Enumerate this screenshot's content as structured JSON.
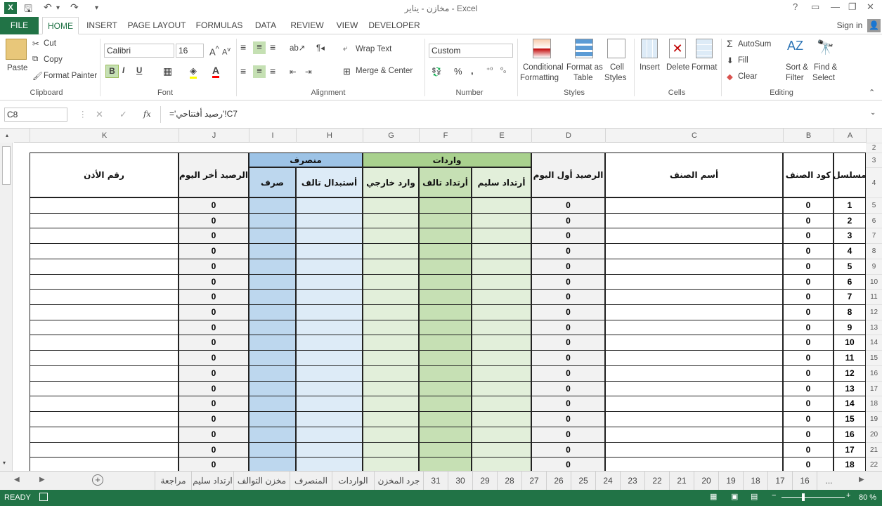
{
  "app": {
    "title": "مخازن - يناير - Excel",
    "help": "?",
    "sign_in": "Sign in"
  },
  "tabs": [
    "FILE",
    "HOME",
    "INSERT",
    "PAGE LAYOUT",
    "FORMULAS",
    "DATA",
    "REVIEW",
    "VIEW",
    "DEVELOPER"
  ],
  "ribbon": {
    "clipboard": {
      "paste": "Paste",
      "cut": "Cut",
      "copy": "Copy",
      "format_painter": "Format Painter",
      "label": "Clipboard"
    },
    "font": {
      "name": "Calibri",
      "size": "16",
      "bold": "B",
      "italic": "I",
      "underline": "U",
      "label": "Font"
    },
    "alignment": {
      "wrap": "Wrap Text",
      "merge": "Merge & Center",
      "label": "Alignment"
    },
    "number": {
      "format": "Custom",
      "percent": "%",
      "comma": ",",
      "label": "Number"
    },
    "styles": {
      "conditional": "Conditional",
      "conditional2": "Formatting",
      "format_as": "Format as",
      "format_as2": "Table",
      "cell": "Cell",
      "cell2": "Styles",
      "label": "Styles"
    },
    "cells": {
      "insert": "Insert",
      "delete": "Delete",
      "format": "Format",
      "label": "Cells"
    },
    "editing": {
      "autosum": "AutoSum",
      "fill": "Fill",
      "clear": "Clear",
      "sort": "Sort &",
      "sort2": "Filter",
      "find": "Find &",
      "find2": "Select",
      "label": "Editing"
    }
  },
  "formula_bar": {
    "name_box": "C8",
    "fx": "fx",
    "formula": "='رصيد أفتتاحي'!C7"
  },
  "columns": [
    "A",
    "B",
    "C",
    "D",
    "E",
    "F",
    "G",
    "H",
    "I",
    "J",
    "K"
  ],
  "row_numbers": [
    "2",
    "3",
    "4",
    "5",
    "6",
    "7",
    "8",
    "9",
    "10",
    "11",
    "12",
    "13",
    "14",
    "15",
    "16",
    "17",
    "18",
    "19",
    "20",
    "21",
    "22"
  ],
  "headers": {
    "serial": "مسلسل",
    "code": "كود الصنف",
    "name": "أسم الصنف",
    "opening": "الرصيد أول اليوم",
    "incoming": "واردات",
    "return_good": "أرتداد سليم",
    "return_damaged": "أرتداد تالف",
    "external": "وارد خارجي",
    "outgoing": "منصرف",
    "replace_damaged": "أستبدال تالف",
    "spent": "صرف",
    "closing": "الرصيد أخر اليوم",
    "ear_number": "رقم الأذن"
  },
  "rows": [
    {
      "serial": "1",
      "code": "0",
      "opening": "0",
      "closing": "0"
    },
    {
      "serial": "2",
      "code": "0",
      "opening": "0",
      "closing": "0"
    },
    {
      "serial": "3",
      "code": "0",
      "opening": "0",
      "closing": "0"
    },
    {
      "serial": "4",
      "code": "0",
      "opening": "0",
      "closing": "0"
    },
    {
      "serial": "5",
      "code": "0",
      "opening": "0",
      "closing": "0"
    },
    {
      "serial": "6",
      "code": "0",
      "opening": "0",
      "closing": "0"
    },
    {
      "serial": "7",
      "code": "0",
      "opening": "0",
      "closing": "0"
    },
    {
      "serial": "8",
      "code": "0",
      "opening": "0",
      "closing": "0"
    },
    {
      "serial": "9",
      "code": "0",
      "opening": "0",
      "closing": "0"
    },
    {
      "serial": "10",
      "code": "0",
      "opening": "0",
      "closing": "0"
    },
    {
      "serial": "11",
      "code": "0",
      "opening": "0",
      "closing": "0"
    },
    {
      "serial": "12",
      "code": "0",
      "opening": "0",
      "closing": "0"
    },
    {
      "serial": "13",
      "code": "0",
      "opening": "0",
      "closing": "0"
    },
    {
      "serial": "14",
      "code": "0",
      "opening": "0",
      "closing": "0"
    },
    {
      "serial": "15",
      "code": "0",
      "opening": "0",
      "closing": "0"
    },
    {
      "serial": "16",
      "code": "0",
      "opening": "0",
      "closing": "0"
    },
    {
      "serial": "17",
      "code": "0",
      "opening": "0",
      "closing": "0"
    },
    {
      "serial": "18",
      "code": "0",
      "opening": "0",
      "closing": "0"
    }
  ],
  "sheet_tabs": [
    "...",
    "16",
    "17",
    "18",
    "19",
    "20",
    "21",
    "22",
    "23",
    "24",
    "25",
    "26",
    "27",
    "28",
    "29",
    "30",
    "31",
    "جرد المخزن",
    "الواردات",
    "المنصرف",
    "مخزن التوالف",
    "ارتداد سليم",
    "مراجعة"
  ],
  "status": {
    "ready": "READY",
    "zoom": "80 %"
  },
  "colors": {
    "excel_green": "#217346",
    "incoming_header": "#a9d18e",
    "incoming_fill": "#e2efda",
    "incoming_mid": "#c6e0b4",
    "outgoing_header": "#9dc3e6",
    "outgoing_fill": "#ddebf7",
    "outgoing_mid": "#bdd7ee",
    "grey": "#f2f2f2"
  }
}
